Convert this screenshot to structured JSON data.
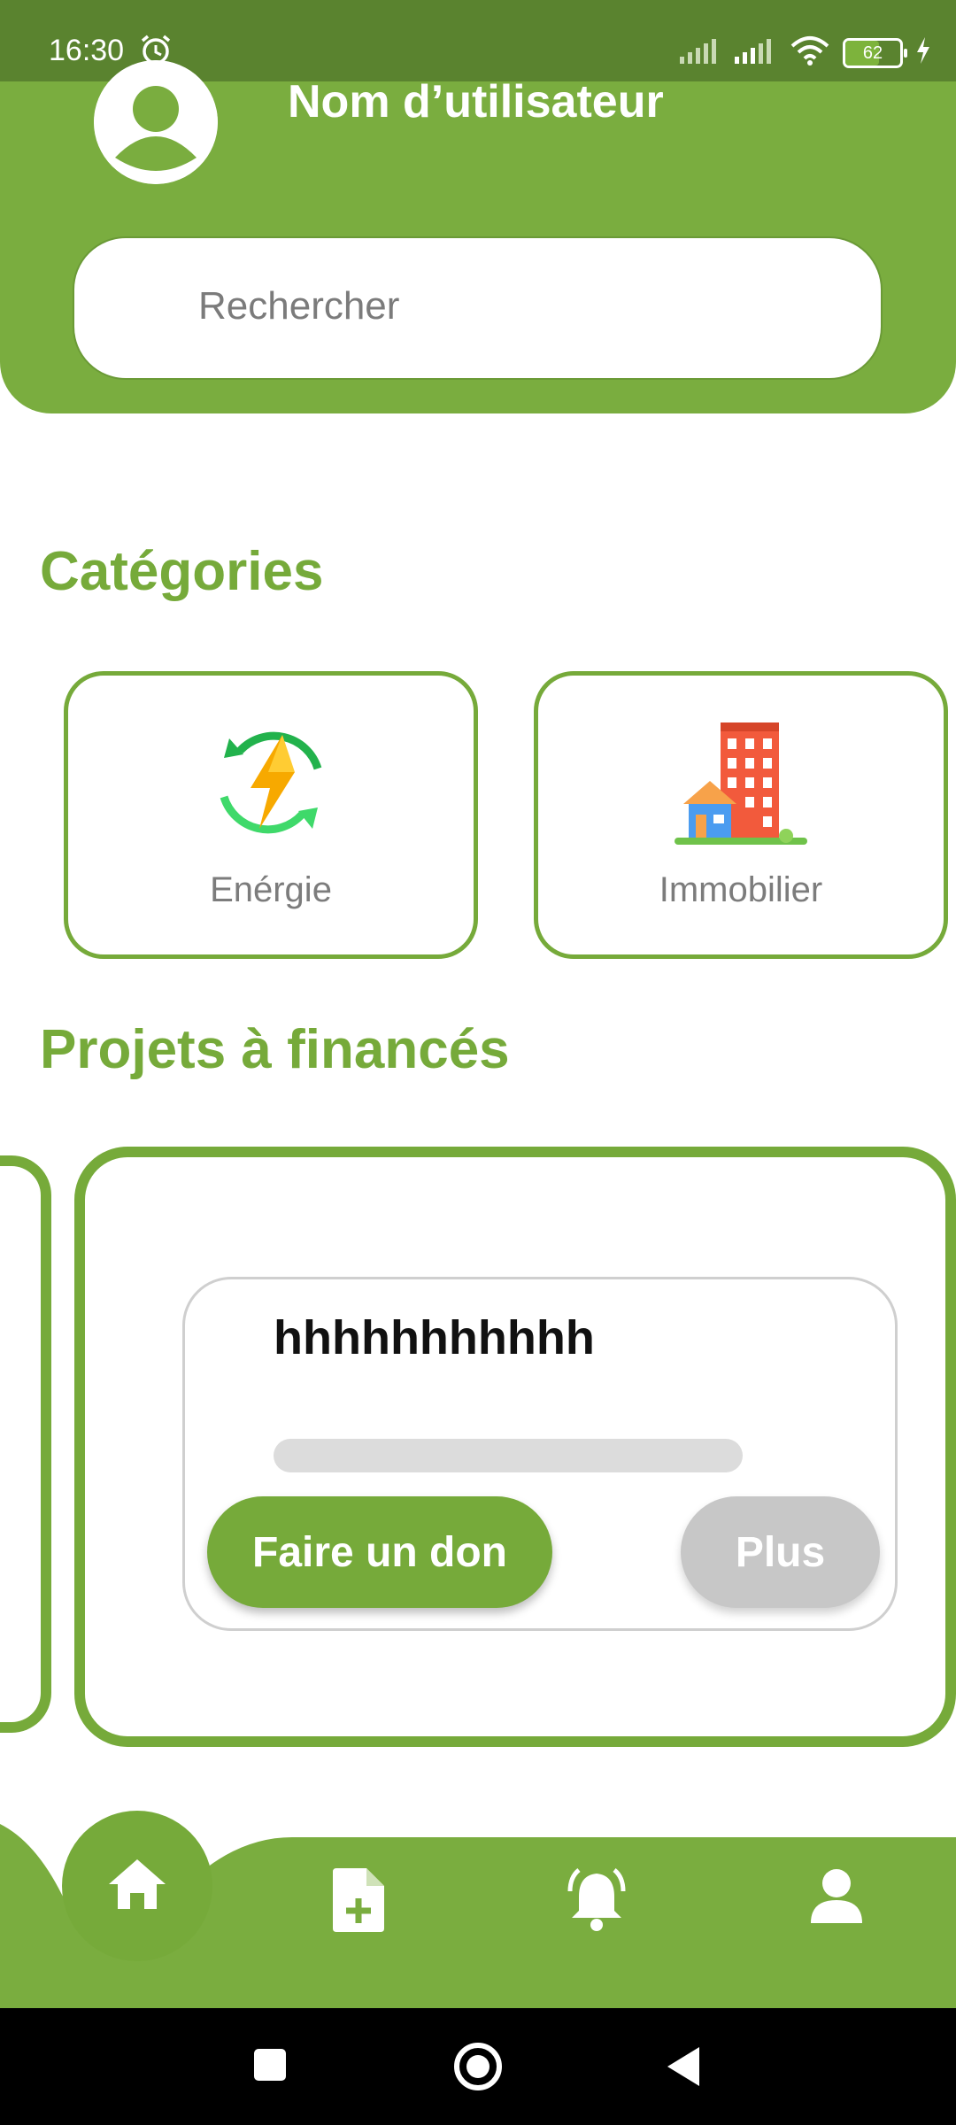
{
  "status_bar": {
    "time": "16:30",
    "battery": "62",
    "alarm_icon": "alarm-icon",
    "signal_icon": "signal-icon",
    "wifi_icon": "wifi-icon",
    "charging_icon": "bolt-icon"
  },
  "header": {
    "user_name": "Nom d’utilisateur",
    "avatar_icon": "user-avatar-icon",
    "search_placeholder": "Rechercher"
  },
  "categories": {
    "title": "Catégories",
    "items": [
      {
        "label": "Enérgie",
        "icon": "energy-bolt-icon"
      },
      {
        "label": "Immobilier",
        "icon": "building-house-icon"
      }
    ]
  },
  "projects": {
    "title": "Projets à financés",
    "items": [
      {
        "name": "hhhhhhhhhhh",
        "progress": 0,
        "donate_label": "Faire un don",
        "more_label": "Plus"
      }
    ]
  },
  "bottom_nav": {
    "items": [
      {
        "icon": "home-icon",
        "active": true
      },
      {
        "icon": "add-document-icon",
        "active": false
      },
      {
        "icon": "bell-icon",
        "active": false
      },
      {
        "icon": "profile-icon",
        "active": false
      }
    ]
  },
  "colors": {
    "primary": "#76aa3a",
    "status_bar": "#5a832f",
    "muted_button": "#c7c7c7"
  }
}
